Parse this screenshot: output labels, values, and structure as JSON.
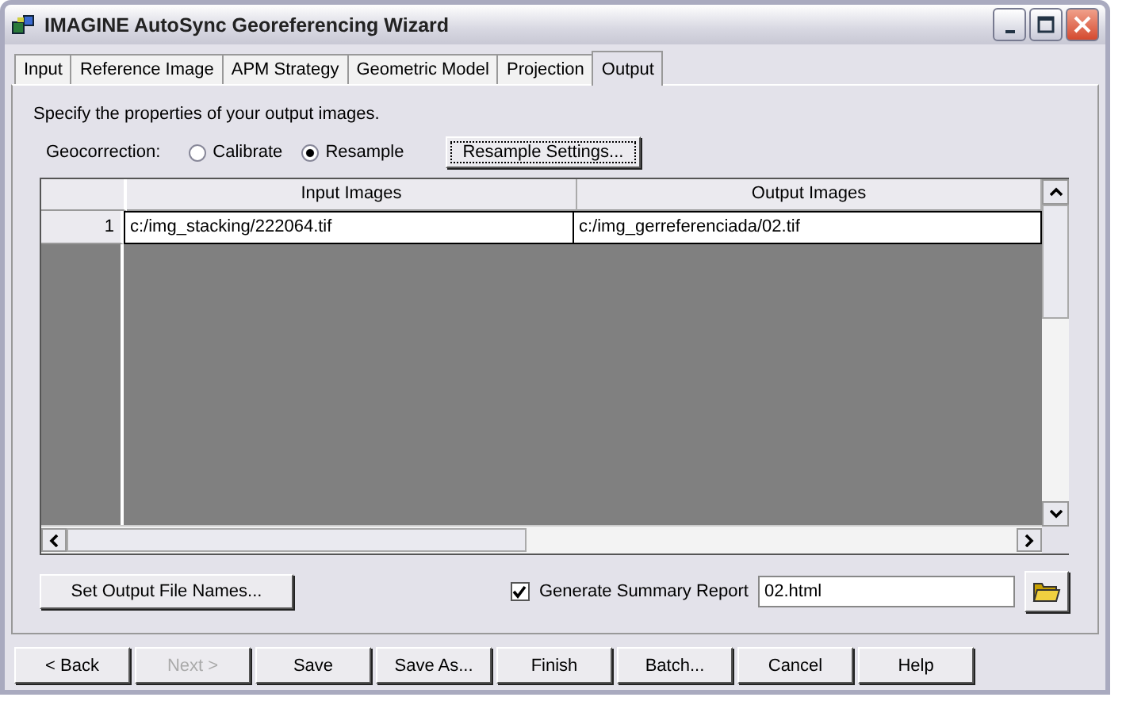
{
  "window": {
    "title": "IMAGINE AutoSync Georeferencing Wizard"
  },
  "tabs": [
    {
      "label": "Input",
      "selected": false
    },
    {
      "label": "Reference Image",
      "selected": false
    },
    {
      "label": "APM Strategy",
      "selected": false
    },
    {
      "label": "Geometric Model",
      "selected": false
    },
    {
      "label": "Projection",
      "selected": false
    },
    {
      "label": "Output",
      "selected": true
    }
  ],
  "description": "Specify the properties of your output images.",
  "geocorrection": {
    "label": "Geocorrection:",
    "options": [
      {
        "label": "Calibrate",
        "selected": false
      },
      {
        "label": "Resample",
        "selected": true
      }
    ],
    "settings_button": "Resample Settings..."
  },
  "table": {
    "columns": [
      "Input Images",
      "Output Images"
    ],
    "rows": [
      {
        "number": "1",
        "input": "c:/img_stacking/222064.tif",
        "output": "c:/img_gerreferenciada/02.tif"
      }
    ]
  },
  "set_names_button": "Set Output File Names...",
  "summary": {
    "label": "Generate Summary Report",
    "checked": true,
    "value": "02.html"
  },
  "footer_buttons": [
    {
      "label": "< Back",
      "disabled": false
    },
    {
      "label": "Next >",
      "disabled": true
    },
    {
      "label": "Save",
      "disabled": false
    },
    {
      "label": "Save As...",
      "disabled": false
    },
    {
      "label": "Finish",
      "disabled": false
    },
    {
      "label": "Batch...",
      "disabled": false
    },
    {
      "label": "Cancel",
      "disabled": false
    },
    {
      "label": "Help",
      "disabled": false
    }
  ]
}
